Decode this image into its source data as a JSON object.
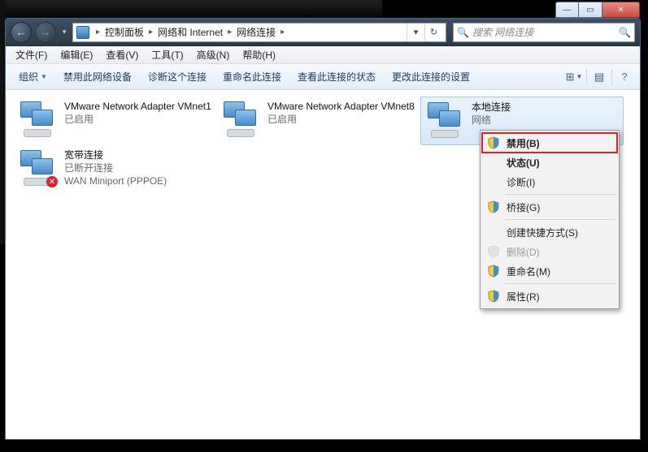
{
  "caption": {
    "min": "—",
    "max": "▭",
    "close": "✕"
  },
  "breadcrumb": {
    "items": [
      "控制面板",
      "网络和 Internet",
      "网络连接"
    ]
  },
  "search": {
    "placeholder": "搜索 网络连接"
  },
  "menu": {
    "file": "文件(F)",
    "edit": "编辑(E)",
    "view": "查看(V)",
    "tools": "工具(T)",
    "advanced": "高级(N)",
    "help": "帮助(H)"
  },
  "cmd": {
    "organize": "组织",
    "disable": "禁用此网络设备",
    "diagnose": "诊断这个连接",
    "rename": "重命名此连接",
    "status": "查看此连接的状态",
    "change": "更改此连接的设置"
  },
  "connections": [
    {
      "name": "VMware Network Adapter VMnet1",
      "sub": "",
      "status": "已启用",
      "type": "vmware"
    },
    {
      "name": "VMware Network Adapter VMnet8",
      "sub": "",
      "status": "已启用",
      "type": "vmware"
    },
    {
      "name": "本地连接",
      "sub": "网络",
      "status": "",
      "type": "lan",
      "selected": true
    },
    {
      "name": "宽带连接",
      "sub": "已断开连接",
      "status": "WAN Miniport (PPPOE)",
      "type": "broadband"
    }
  ],
  "context_menu": {
    "disable": "禁用(B)",
    "status": "状态(U)",
    "diagnose": "诊断(I)",
    "bridge": "桥接(G)",
    "shortcut": "创建快捷方式(S)",
    "delete": "删除(D)",
    "rename": "重命名(M)",
    "properties": "属性(R)"
  }
}
